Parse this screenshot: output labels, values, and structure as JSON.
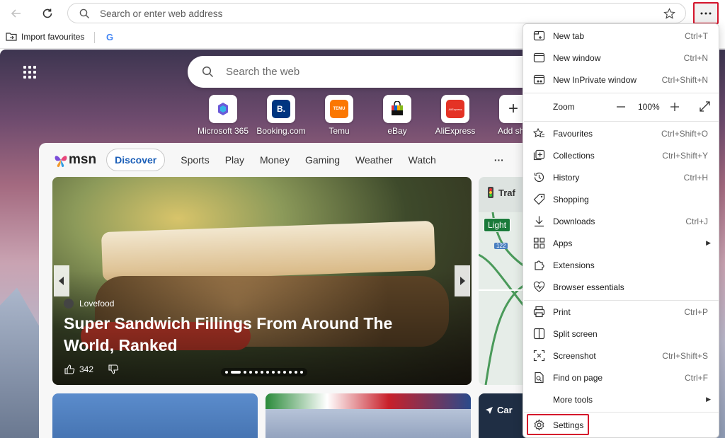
{
  "browser": {
    "address_placeholder": "Search or enter web address",
    "more_menu_icon": "ellipsis-icon",
    "favourites_bar": {
      "import_label": "Import favourites",
      "google_icon_text": "G"
    }
  },
  "newtab": {
    "search_placeholder": "Search the web",
    "quick_links": [
      {
        "label": "Microsoft 365",
        "icon_text": "",
        "color": "#5b6bd8"
      },
      {
        "label": "Booking.com",
        "icon_text": "B.",
        "color": "#003580"
      },
      {
        "label": "Temu",
        "icon_text": "TEMU",
        "color": "#fb7701"
      },
      {
        "label": "eBay",
        "icon_text": "",
        "color": "#e53238"
      },
      {
        "label": "AliExpress",
        "icon_text": "AliExpress",
        "color": "#e43225"
      },
      {
        "label": "Add sho",
        "icon_text": "+",
        "color": "#333333"
      }
    ],
    "msn": {
      "logo": "msn",
      "tabs": [
        "Discover",
        "Sports",
        "Play",
        "Money",
        "Gaming",
        "Weather",
        "Watch"
      ],
      "more": "···",
      "hero": {
        "source": "Lovefood",
        "title": "Super Sandwich Fillings From Around The World, Ranked",
        "likes": "342"
      },
      "side_card": {
        "title": "Traf",
        "map_label": "Light",
        "road": "122"
      },
      "bottom_card_label": "Car"
    }
  },
  "menu": {
    "zoom": {
      "label": "Zoom",
      "value": "100%"
    },
    "items": [
      {
        "label": "New tab",
        "shortcut": "Ctrl+T"
      },
      {
        "label": "New window",
        "shortcut": "Ctrl+N"
      },
      {
        "label": "New InPrivate window",
        "shortcut": "Ctrl+Shift+N"
      },
      {
        "label": "Favourites",
        "shortcut": "Ctrl+Shift+O"
      },
      {
        "label": "Collections",
        "shortcut": "Ctrl+Shift+Y"
      },
      {
        "label": "History",
        "shortcut": "Ctrl+H"
      },
      {
        "label": "Shopping",
        "shortcut": ""
      },
      {
        "label": "Downloads",
        "shortcut": "Ctrl+J"
      },
      {
        "label": "Apps",
        "shortcut": ""
      },
      {
        "label": "Extensions",
        "shortcut": ""
      },
      {
        "label": "Browser essentials",
        "shortcut": ""
      },
      {
        "label": "Print",
        "shortcut": "Ctrl+P"
      },
      {
        "label": "Split screen",
        "shortcut": ""
      },
      {
        "label": "Screenshot",
        "shortcut": "Ctrl+Shift+S"
      },
      {
        "label": "Find on page",
        "shortcut": "Ctrl+F"
      },
      {
        "label": "More tools",
        "shortcut": ""
      },
      {
        "label": "Settings",
        "shortcut": ""
      }
    ]
  },
  "colors": {
    "highlight": "#d4142b",
    "accent": "#1b5fb8"
  }
}
